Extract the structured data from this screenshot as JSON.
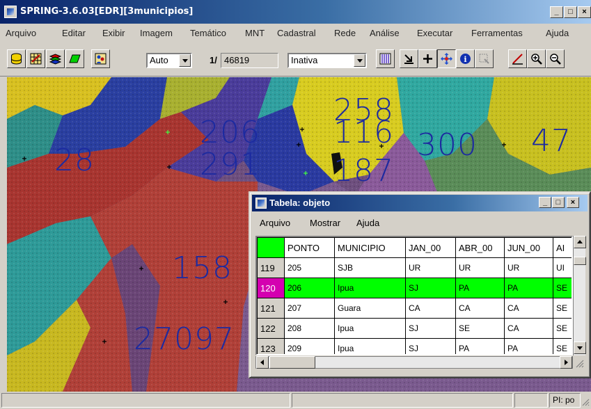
{
  "window": {
    "title": "SPRING-3.6.03[EDR][3municipios]",
    "min_label": "_",
    "max_label": "□",
    "close_label": "×"
  },
  "menu": [
    "Arquivo",
    "Editar",
    "Exibir",
    "Imagem",
    "Temático",
    "MNT",
    "Cadastral",
    "Rede",
    "Análise",
    "Executar",
    "Ferramentas",
    "Ajuda"
  ],
  "toolbar": {
    "scale_mode": "Auto",
    "scale_prefix": "1/",
    "scale_value": "46819",
    "state": "Inativa",
    "icons": [
      "database-icon",
      "table-icon",
      "layers-icon",
      "polygon-icon",
      "people-icon",
      "columns-icon",
      "cursor-select-icon",
      "plus-icon",
      "pan-icon",
      "info-icon",
      "select-box-icon",
      "edit-line-icon",
      "zoom-in-icon",
      "zoom-out-icon"
    ]
  },
  "map": {
    "labels": [
      {
        "id": "label-28",
        "text": "28"
      },
      {
        "id": "label-206",
        "text": "206"
      },
      {
        "id": "label-291",
        "text": "291"
      },
      {
        "id": "label-258",
        "text": "258"
      },
      {
        "id": "label-116",
        "text": "116"
      },
      {
        "id": "label-187",
        "text": "187"
      },
      {
        "id": "label-300",
        "text": "300"
      },
      {
        "id": "label-47",
        "text": "47"
      },
      {
        "id": "label-158",
        "text": "158"
      },
      {
        "id": "label-27097",
        "text": "27097"
      }
    ]
  },
  "table_window": {
    "title": "Tabela: objeto",
    "menu": [
      "Arquivo",
      "Mostrar",
      "Ajuda"
    ],
    "columns": [
      "PONTO",
      "MUNICIPIO",
      "JAN_00",
      "ABR_00",
      "JUN_00",
      "AI"
    ],
    "rows": [
      {
        "n": "119",
        "cells": [
          "205",
          "SJB",
          "UR",
          "UR",
          "UR",
          "UI"
        ],
        "selected": false
      },
      {
        "n": "120",
        "cells": [
          "206",
          "Ipua",
          "SJ",
          "PA",
          "PA",
          "SE"
        ],
        "selected": true
      },
      {
        "n": "121",
        "cells": [
          "207",
          "Guara",
          "CA",
          "CA",
          "CA",
          "SE"
        ],
        "selected": false
      },
      {
        "n": "122",
        "cells": [
          "208",
          "Ipua",
          "SJ",
          "SE",
          "CA",
          "SE"
        ],
        "selected": false
      },
      {
        "n": "123",
        "cells": [
          "209",
          "Ipua",
          "SJ",
          "PA",
          "PA",
          "SE"
        ],
        "selected": false
      }
    ]
  },
  "status": {
    "plane": "PI: po"
  },
  "colors": {
    "selected_row": "#00ff00",
    "selected_row_header": "#d400b0",
    "label_color": "#1c2aa0"
  }
}
